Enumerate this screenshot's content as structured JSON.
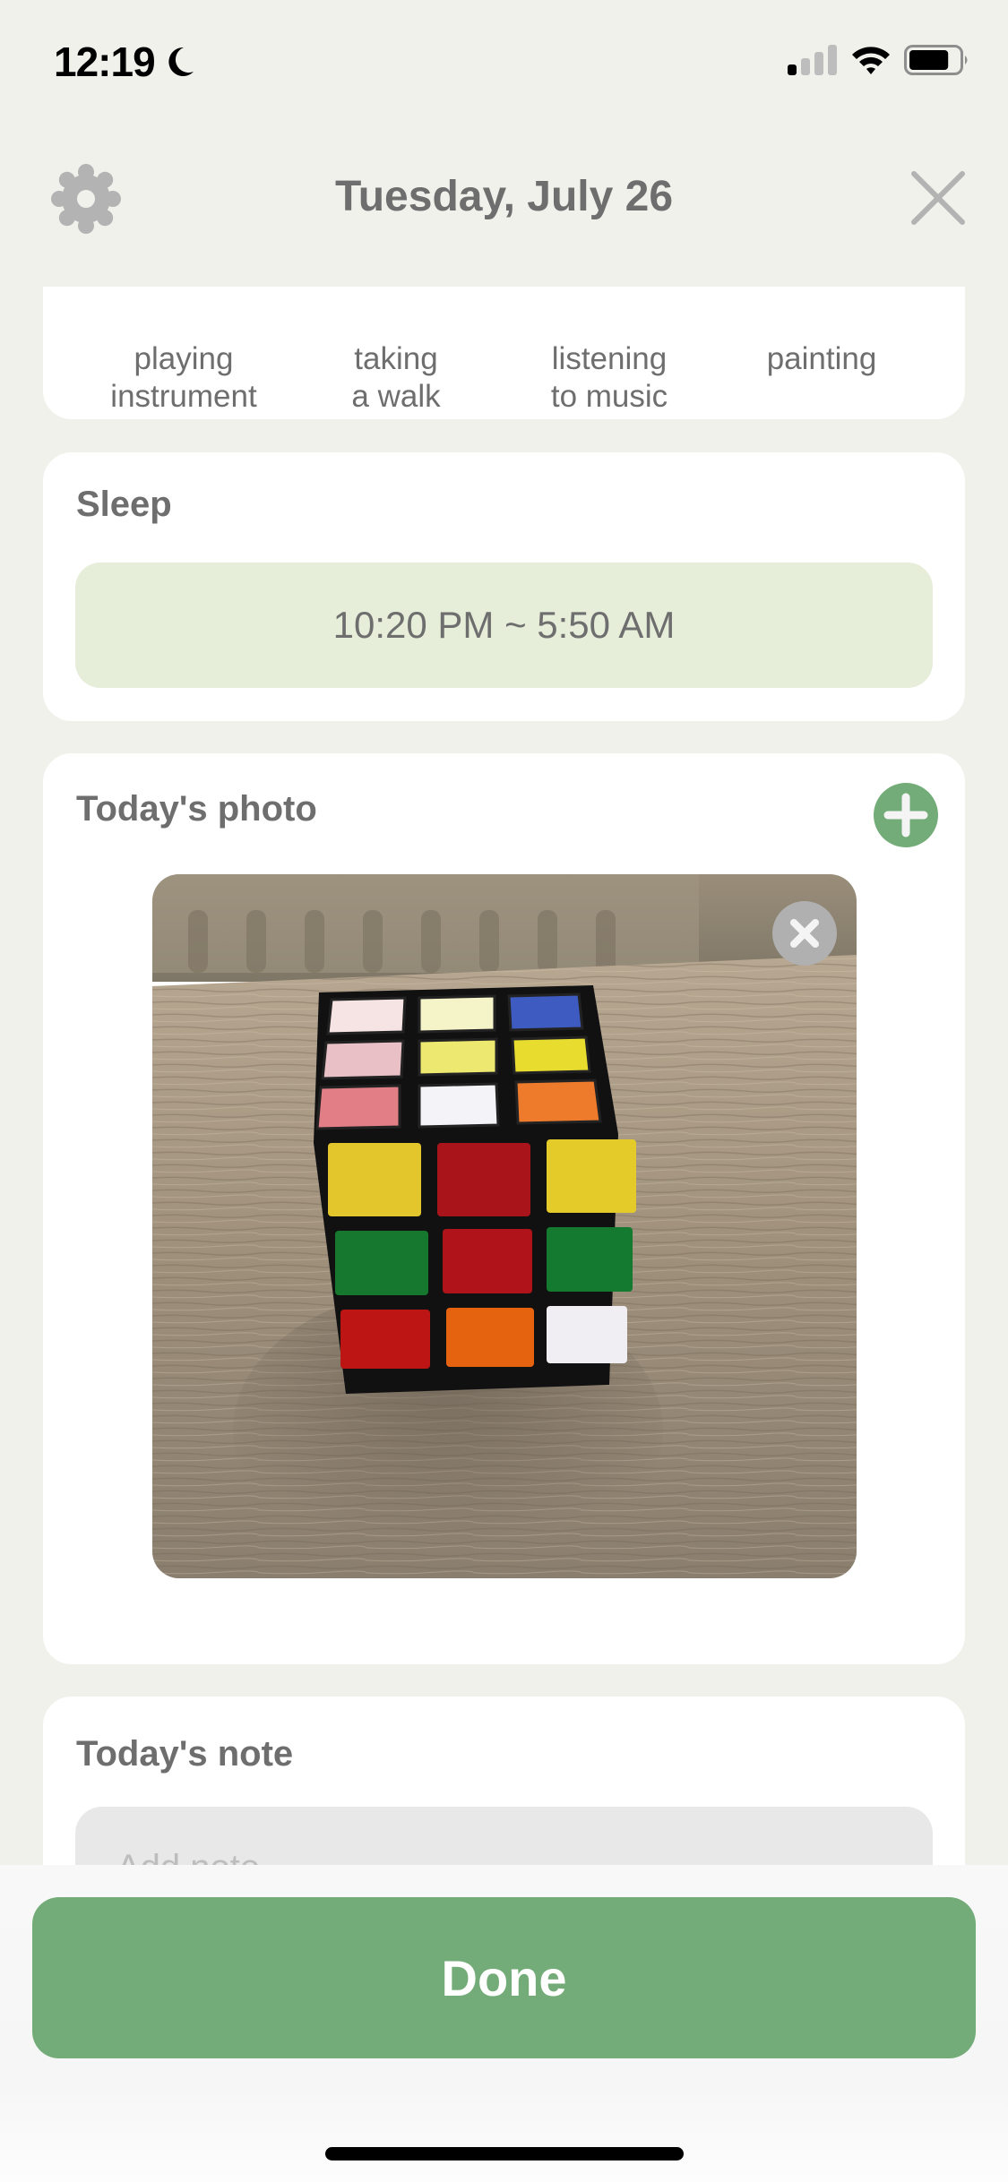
{
  "status_bar": {
    "time": "12:19",
    "focus_icon": "moon-icon",
    "signal_bars_active": 1,
    "signal_bars_total": 4,
    "wifi_icon": "wifi-icon",
    "battery_level": 0.8
  },
  "header": {
    "title": "Tuesday, July 26",
    "settings_icon": "gear-icon",
    "close_icon": "close-icon"
  },
  "activities": {
    "items": [
      {
        "line1": "playing",
        "line2": "instrument"
      },
      {
        "line1": "taking",
        "line2": "a walk"
      },
      {
        "line1": "listening",
        "line2": "to music"
      },
      {
        "line1": "painting",
        "line2": ""
      }
    ]
  },
  "sleep": {
    "title": "Sleep",
    "range": "10:20 PM ~ 5:50 AM"
  },
  "photo": {
    "title": "Today's photo",
    "add_icon": "plus-circle-icon",
    "remove_icon": "close-circle-icon",
    "image_description": "Rubik's cube on a wooden table"
  },
  "note": {
    "title": "Today's note",
    "placeholder": "Add note",
    "value": ""
  },
  "footer": {
    "done_label": "Done"
  },
  "colors": {
    "accent_green": "#73AC78",
    "sleep_pill_bg": "#E6EEDA",
    "background": "#F1F1EC",
    "text_gray": "#6E6E6E",
    "icon_gray": "#B3B3B3"
  }
}
